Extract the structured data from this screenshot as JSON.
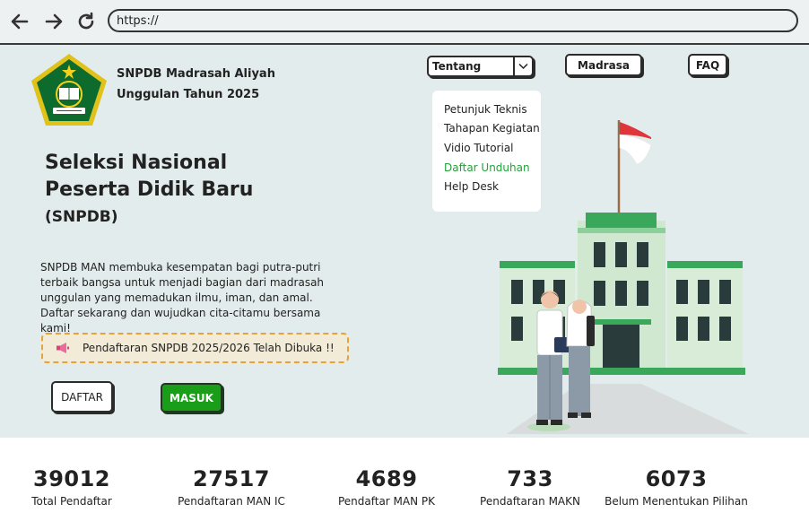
{
  "browser": {
    "url": "https://"
  },
  "header": {
    "brand_line1": "SNPDB Madrasah Aliyah",
    "brand_line2": "Unggulan Tahun 2025",
    "logo_icon": "kemenag-logo",
    "nav": {
      "tentang_select": "Tentang",
      "madrasa_label": "Madrasa",
      "faq_label": "FAQ"
    }
  },
  "dropdown": {
    "items": [
      {
        "label": "Petunjuk Teknis"
      },
      {
        "label": "Tahapan Kegiatan"
      },
      {
        "label": "Vidio Tutorial"
      },
      {
        "label": "Daftar Unduhan",
        "active": true
      },
      {
        "label": "Help Desk"
      }
    ]
  },
  "hero": {
    "title_line1": "Seleksi Nasional",
    "title_line2": "Peserta Didik Baru",
    "title_line3": "(SNPDB)",
    "description": "SNPDB MAN membuka kesempatan bagi putra-putri terbaik bangsa untuk menjadi bagian dari madrasah unggulan yang memadukan ilmu, iman, dan amal. Daftar sekarang dan wujudkan cita-citamu bersama kami!",
    "notice_icon": "megaphone-icon",
    "notice": "Pendaftaran SNPDB 2025/2026 Telah Dibuka !!",
    "daftar_label": "DAFTAR",
    "masuk_label": "MASUK"
  },
  "stats": [
    {
      "value": "39012",
      "label": "Total Pendaftar"
    },
    {
      "value": "27517",
      "label": "Pendaftaran MAN IC"
    },
    {
      "value": "4689",
      "label": "Pendaftar MAN PK"
    },
    {
      "value": "733",
      "label": "Pendaftaran MAKN"
    },
    {
      "value": "6073",
      "label": "Belum Menentukan Pilihan"
    }
  ],
  "colors": {
    "hero_bg": "#e3ecec",
    "accent_green": "#1a9e1a",
    "active_link": "#24a03a",
    "notice_border": "#e6a33b"
  }
}
